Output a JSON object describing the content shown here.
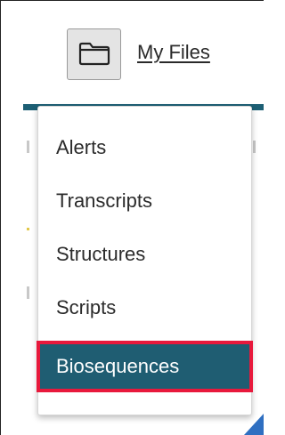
{
  "header": {
    "my_files_label": "My Files",
    "folder_icon": "folder-icon"
  },
  "menu": {
    "items": [
      {
        "label": "Alerts"
      },
      {
        "label": "Transcripts"
      },
      {
        "label": "Structures"
      },
      {
        "label": "Scripts"
      },
      {
        "label": "Biosequences",
        "selected": true
      }
    ]
  },
  "colors": {
    "accent": "#1f5d72",
    "highlight_border": "#e8193c",
    "corner_triangle": "#2f6fc1"
  }
}
